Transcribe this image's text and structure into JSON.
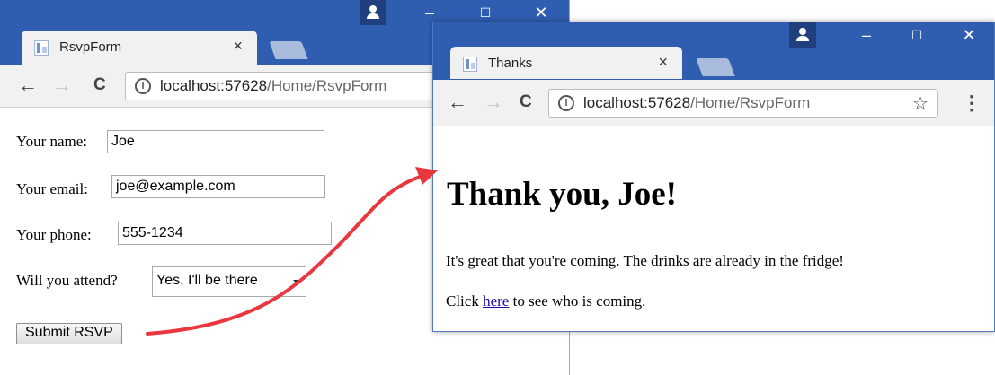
{
  "window_left": {
    "tab_title": "RsvpForm",
    "url_host": "localhost:57628",
    "url_path": "/Home/RsvpForm",
    "form": {
      "name_label": "Your name:",
      "name_value": "Joe",
      "email_label": "Your email:",
      "email_value": "joe@example.com",
      "phone_label": "Your phone:",
      "phone_value": "555-1234",
      "attend_label": "Will you attend?",
      "attend_value": "Yes, I'll be there",
      "submit_label": "Submit RSVP"
    }
  },
  "window_right": {
    "tab_title": "Thanks",
    "url_host": "localhost:57628",
    "url_path": "/Home/RsvpForm",
    "heading": "Thank you, Joe!",
    "message": "It's great that you're coming. The drinks are already in the fridge!",
    "click_prefix": "Click ",
    "link_text": "here",
    "click_suffix": " to see who is coming."
  },
  "icons": {
    "close": "×",
    "back": "←",
    "forward": "→",
    "reload": "C",
    "minimize": "–",
    "maximize": "☐",
    "window_close": "✕",
    "star": "☆",
    "menu": "⋮",
    "info": "i"
  },
  "colors": {
    "titlebar": "#2f5db0",
    "arrow": "#e8383d",
    "link": "#1a0dab"
  }
}
